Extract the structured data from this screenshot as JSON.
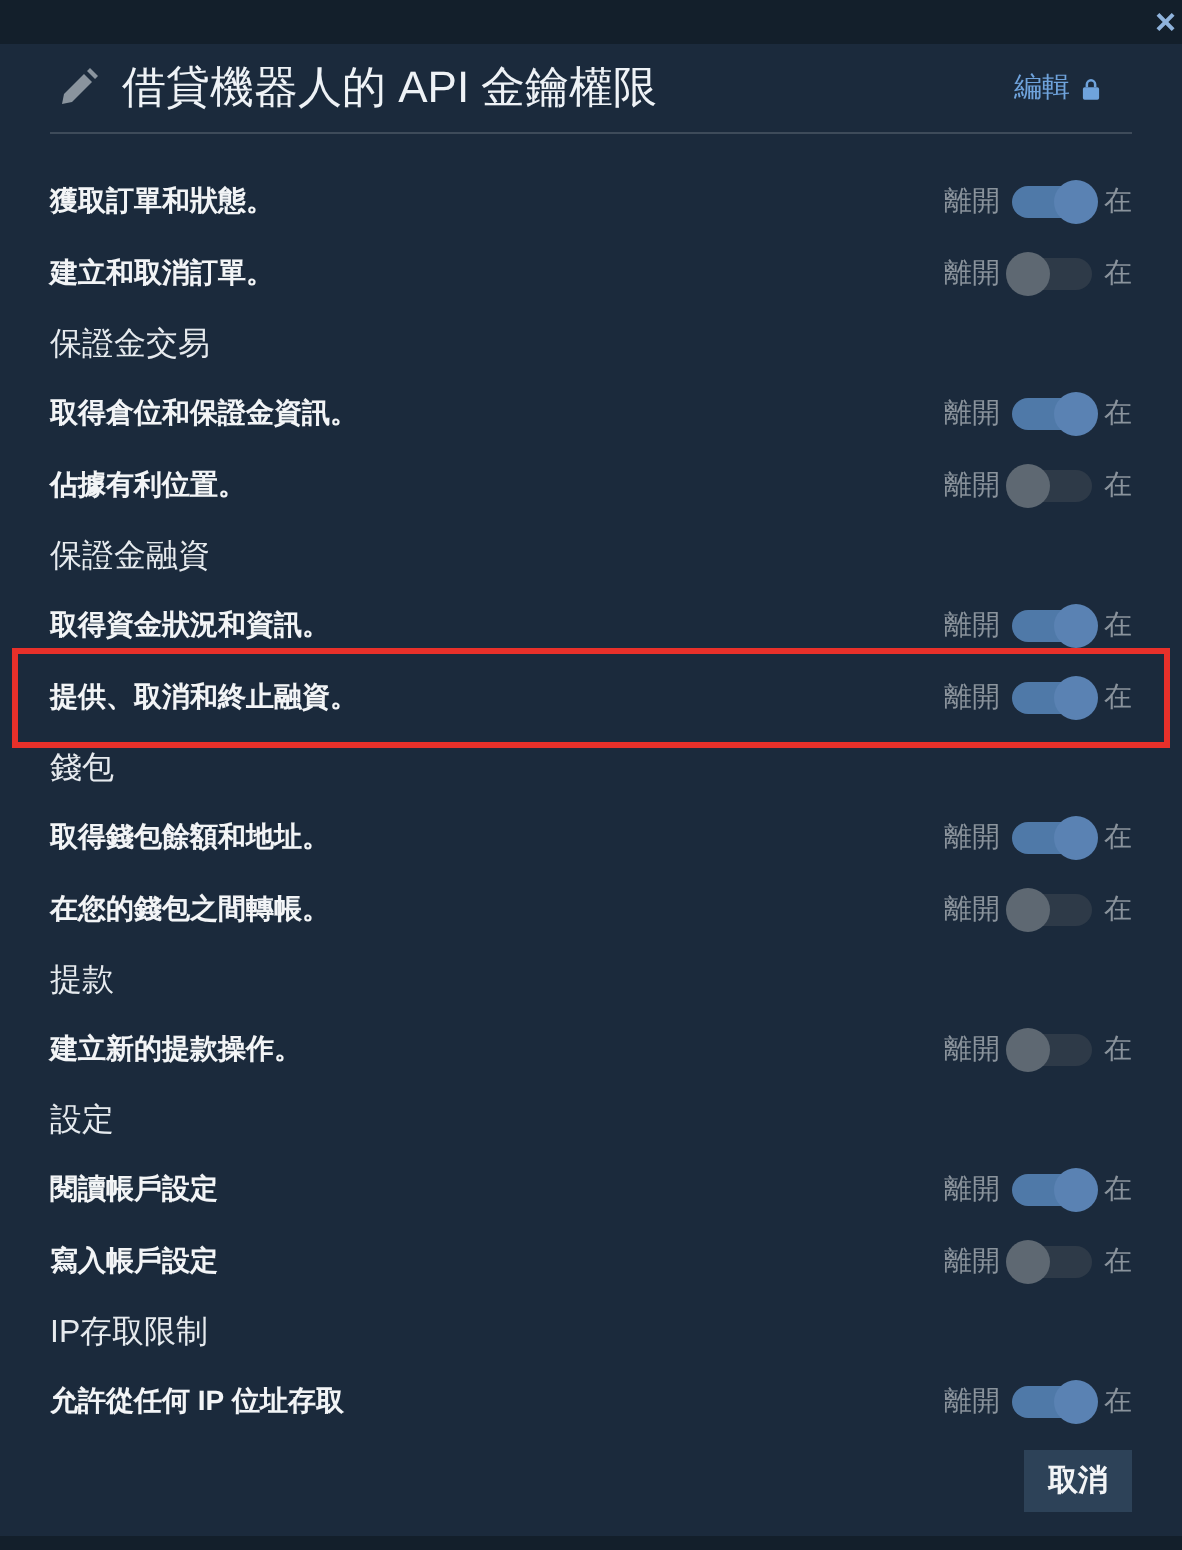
{
  "close_label": "×",
  "title": "借貸機器人的 API 金鑰權限",
  "edit_link": "編輯",
  "groups": [
    {
      "items": [
        {
          "label": "獲取訂單和狀態。",
          "off_label": "離開",
          "on_label": "在",
          "on": true,
          "highlighted": false
        },
        {
          "label": "建立和取消訂單。",
          "off_label": "離開",
          "on_label": "在",
          "on": false,
          "highlighted": false
        }
      ]
    },
    {
      "title": "保證金交易",
      "items": [
        {
          "label": "取得倉位和保證金資訊。",
          "off_label": "離開",
          "on_label": "在",
          "on": true,
          "highlighted": false
        },
        {
          "label": "佔據有利位置。",
          "off_label": "離開",
          "on_label": "在",
          "on": false,
          "highlighted": false
        }
      ]
    },
    {
      "title": "保證金融資",
      "items": [
        {
          "label": "取得資金狀況和資訊。",
          "off_label": "離開",
          "on_label": "在",
          "on": true,
          "highlighted": false
        },
        {
          "label": "提供、取消和終止融資。",
          "off_label": "離開",
          "on_label": "在",
          "on": true,
          "highlighted": true
        }
      ]
    },
    {
      "title": "錢包",
      "items": [
        {
          "label": "取得錢包餘額和地址。",
          "off_label": "離開",
          "on_label": "在",
          "on": true,
          "highlighted": false
        },
        {
          "label": "在您的錢包之間轉帳。",
          "off_label": "離開",
          "on_label": "在",
          "on": false,
          "highlighted": false
        }
      ]
    },
    {
      "title": "提款",
      "items": [
        {
          "label": "建立新的提款操作。",
          "off_label": "離開",
          "on_label": "在",
          "on": false,
          "highlighted": false
        }
      ]
    },
    {
      "title": "設定",
      "items": [
        {
          "label": "閱讀帳戶設定",
          "off_label": "離開",
          "on_label": "在",
          "on": true,
          "highlighted": false
        },
        {
          "label": "寫入帳戶設定",
          "off_label": "離開",
          "on_label": "在",
          "on": false,
          "highlighted": false
        }
      ]
    },
    {
      "title": "IP存取限制",
      "items": [
        {
          "label": "允許從任何 IP 位址存取",
          "off_label": "離開",
          "on_label": "在",
          "on": true,
          "highlighted": false
        }
      ]
    }
  ],
  "cancel_button": "取消"
}
